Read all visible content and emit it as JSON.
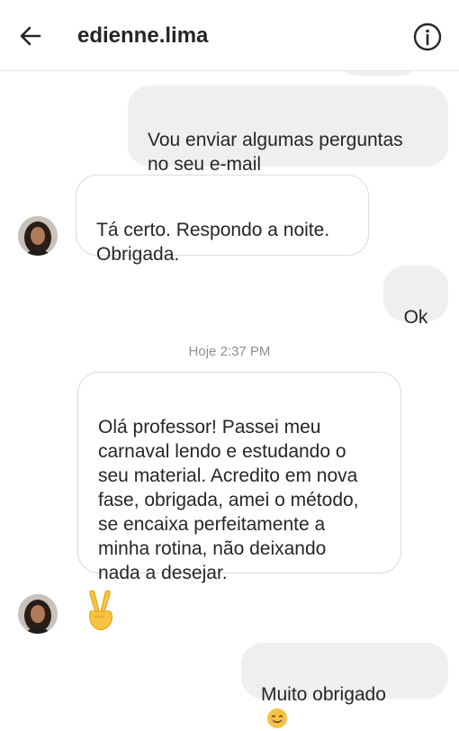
{
  "header": {
    "username": "edienne.lima",
    "back_icon": "arrow-left-icon",
    "info_icon": "info-circle-icon"
  },
  "messages": [
    {
      "text": "Vou enviar algumas perguntas\nno seu e-mail",
      "direction": "outgoing"
    },
    {
      "text": "Tá certo. Respondo a noite.\nObrigada.",
      "direction": "incoming"
    },
    {
      "text": "Ok",
      "direction": "outgoing"
    },
    {
      "text": "Olá professor!  Passei meu\ncarnaval lendo e estudando o\nseu material. Acredito em nova\nfase, obrigada,  amei o método,\nse encaixa perfeitamente a\nminha rotina, não deixando\nnada a desejar.",
      "direction": "incoming"
    },
    {
      "text": "✌",
      "direction": "incoming",
      "emoji_icon": "victory-hand-icon"
    },
    {
      "text": "Muito obrigado",
      "direction": "outgoing",
      "emoji_icon": "smiling-face-icon"
    }
  ],
  "timestamp": "Hoje 2:37 PM",
  "colors": {
    "outgoing_bubble": "#efefef",
    "incoming_border": "#dbdbdb",
    "timestamp": "#8e8e8e",
    "text": "#262626"
  }
}
